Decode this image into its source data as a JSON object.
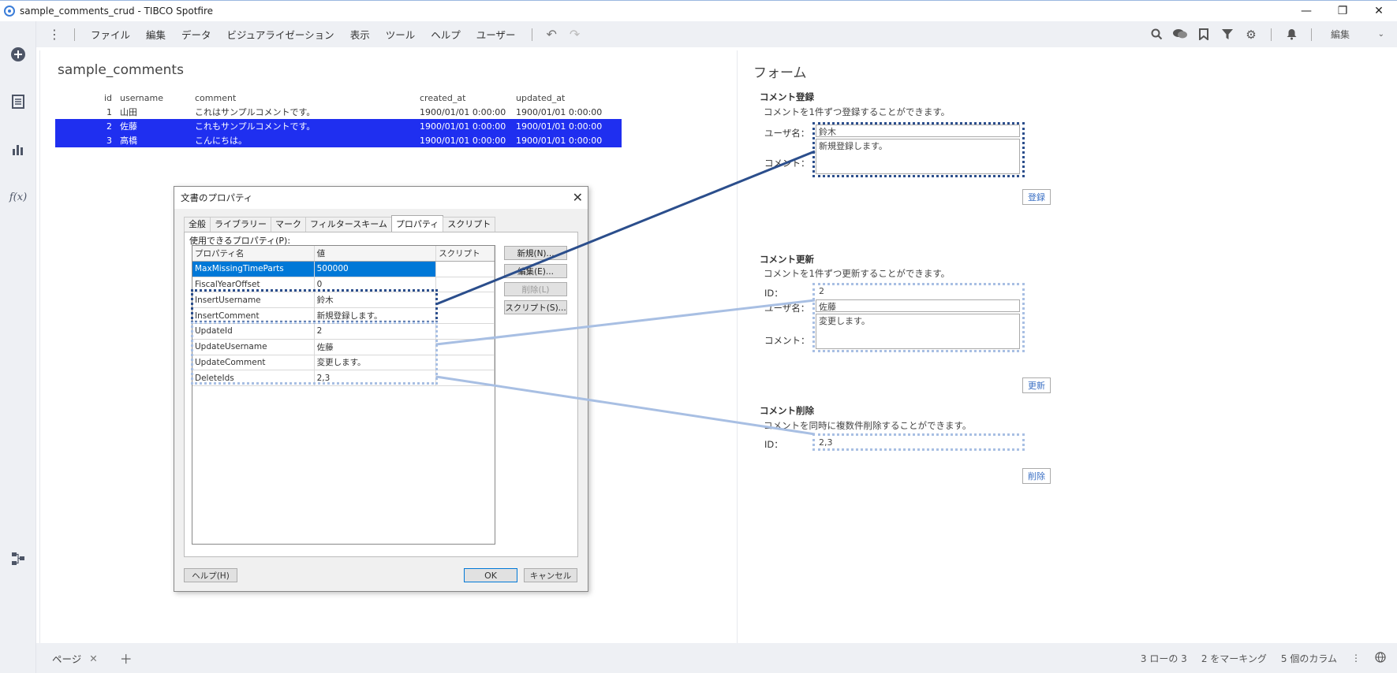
{
  "window": {
    "title": "sample_comments_crud - TIBCO Spotfire",
    "minimize": "—",
    "restore": "❐",
    "close": "✕"
  },
  "menu": {
    "items": [
      "ファイル",
      "編集",
      "データ",
      "ビジュアライゼーション",
      "表示",
      "ツール",
      "ヘルプ",
      "ユーザー"
    ],
    "edit_mode": "編集"
  },
  "table_panel": {
    "title": "sample_comments",
    "columns": [
      "id",
      "username",
      "comment",
      "created_at",
      "updated_at"
    ],
    "rows": [
      {
        "id": "1",
        "username": "山田",
        "comment": "これはサンプルコメントです。",
        "created_at": "1900/01/01 0:00:00",
        "updated_at": "1900/01/01 0:00:00",
        "selected": false
      },
      {
        "id": "2",
        "username": "佐藤",
        "comment": "これもサンプルコメントです。",
        "created_at": "1900/01/01 0:00:00",
        "updated_at": "1900/01/01 0:00:00",
        "selected": true
      },
      {
        "id": "3",
        "username": "高橋",
        "comment": "こんにちは。",
        "created_at": "1900/01/01 0:00:00",
        "updated_at": "1900/01/01 0:00:00",
        "selected": true
      }
    ],
    "selection_color": "#1f2ff0"
  },
  "dialog": {
    "title": "文書のプロパティ",
    "tabs": [
      "全般",
      "ライブラリー",
      "マーク",
      "フィルタースキーム",
      "プロパティ",
      "スクリプト"
    ],
    "active_tab": "プロパティ",
    "available_label": "使用できるプロパティ(P):",
    "grid_headers": [
      "プロパティ名",
      "値",
      "スクリプト"
    ],
    "properties": [
      {
        "name": "MaxMissingTimeParts",
        "value": "500000",
        "selected": true
      },
      {
        "name": "FiscalYearOffset",
        "value": "0",
        "selected": false
      },
      {
        "name": "InsertUsername",
        "value": "鈴木",
        "selected": false
      },
      {
        "name": "InsertComment",
        "value": "新規登録します。",
        "selected": false
      },
      {
        "name": "UpdateId",
        "value": "2",
        "selected": false
      },
      {
        "name": "UpdateUsername",
        "value": "佐藤",
        "selected": false
      },
      {
        "name": "UpdateComment",
        "value": "変更します。",
        "selected": false
      },
      {
        "name": "DeleteIds",
        "value": "2,3",
        "selected": false
      }
    ],
    "buttons": {
      "new": "新規(N)...",
      "edit": "編集(E)...",
      "delete": "削除(L)",
      "script": "スクリプト(S)...",
      "help": "ヘルプ(H)",
      "ok": "OK",
      "cancel": "キャンセル"
    }
  },
  "form_panel": {
    "title": "フォーム",
    "register": {
      "title": "コメント登録",
      "desc": "コメントを1件ずつ登録することができます。",
      "user_label": "ユーザ名：",
      "user_value": "鈴木",
      "comment_label": "コメント：",
      "comment_value": "新規登録します。",
      "button": "登録"
    },
    "update": {
      "title": "コメント更新",
      "desc": "コメントを1件ずつ更新することができます。",
      "id_label": "ID：",
      "id_value": "2",
      "user_label": "ユーザ名：",
      "user_value": "佐藤",
      "comment_label": "コメント：",
      "comment_value": "変更します。",
      "button": "更新"
    },
    "delete": {
      "title": "コメント削除",
      "desc": "コメントを同時に複数件削除することができます。",
      "id_label": "ID：",
      "id_value": "2,3",
      "button": "削除"
    }
  },
  "statusbar": {
    "page_tab": "ページ",
    "rows": "3 ローの 3",
    "marked": "2 をマーキング",
    "columns": "5 個のカラム"
  },
  "colors": {
    "accent_dark": "#2b4e8c",
    "accent_light": "#a8bfe3"
  }
}
